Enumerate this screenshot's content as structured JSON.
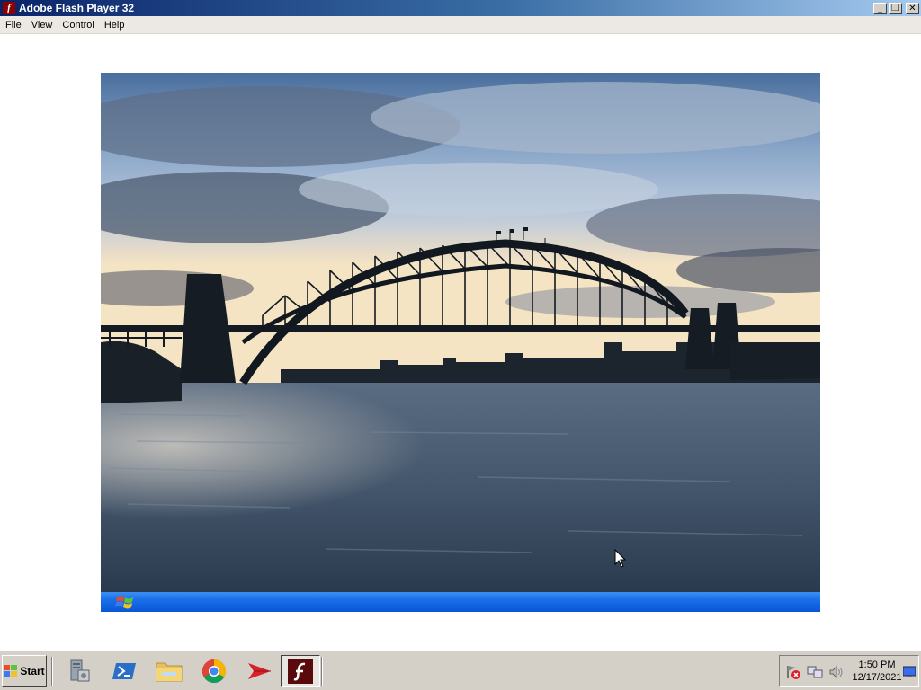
{
  "window": {
    "title": "Adobe Flash Player 32",
    "icon": "flash-icon",
    "minimize_glyph": "_",
    "restore_glyph": "❐",
    "close_glyph": "✕"
  },
  "menu": {
    "items": [
      {
        "label": "File"
      },
      {
        "label": "View"
      },
      {
        "label": "Control"
      },
      {
        "label": "Help"
      }
    ]
  },
  "content": {
    "image": "harbour-bridge-photo"
  },
  "taskbar": {
    "start_label": "Start",
    "apps": [
      {
        "icon": "server-manager-icon"
      },
      {
        "icon": "powershell-icon"
      },
      {
        "icon": "file-explorer-icon"
      },
      {
        "icon": "chrome-icon"
      },
      {
        "icon": "arrow-app-icon"
      },
      {
        "icon": "flash-player-icon",
        "active": true
      }
    ],
    "tray": {
      "icons": [
        "flag-alert-icon",
        "network-icon",
        "volume-icon",
        "show-desktop-icon"
      ],
      "time": "1:50 PM",
      "date": "12/17/2021"
    }
  },
  "colors": {
    "titlebar_start": "#0a246a",
    "titlebar_end": "#a6caf0",
    "xp_bar": "#1a6ee8"
  }
}
